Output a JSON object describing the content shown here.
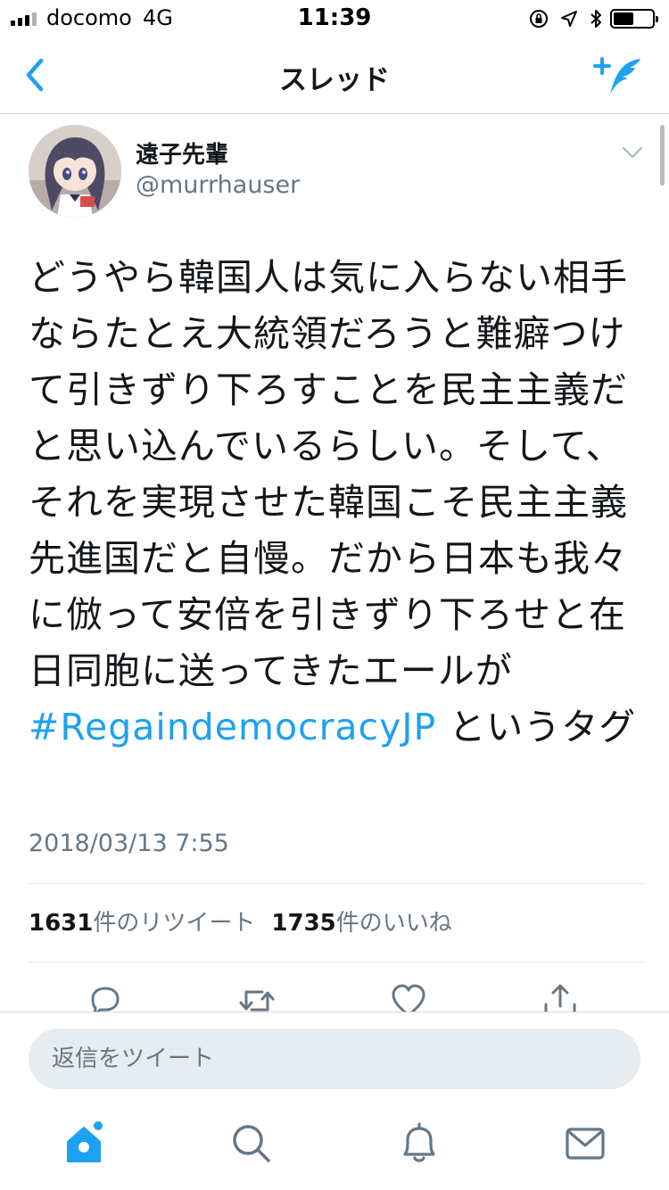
{
  "status_bar": {
    "carrier": "docomo",
    "network": "4G",
    "time": "11:39",
    "icons": [
      "signal-icon",
      "orientation-lock-icon",
      "location-icon",
      "bluetooth-icon",
      "battery-icon"
    ]
  },
  "nav": {
    "title": "スレッド",
    "back_icon": "chevron-left-icon",
    "compose_icon": "compose-tweet-icon"
  },
  "tweet": {
    "author_name": "遠子先輩",
    "author_handle": "@murrhauser",
    "text_before_hashtag": "どうやら韓国人は気に入らない相手ならたとえ大統領だろうと難癖つけて引きずり下ろすことを民主主義だと思い込んでいるらしい。そして、それを実現させた韓国こそ民主主義先進国だと自慢。だから日本も我々に倣って安倍を引きずり下ろせと在日同胞に送ってきたエールが ",
    "hashtag": "#RegaindemocracyJP",
    "text_after_hashtag": " というタグ",
    "timestamp": "2018/03/13 7:55",
    "retweet_count": "1631",
    "retweet_label": "件のリツイート",
    "like_count": "1735",
    "like_label": "件のいいね"
  },
  "actions": [
    "reply-icon",
    "retweet-icon",
    "like-icon",
    "share-icon"
  ],
  "reply_bar": {
    "placeholder": "返信をツイート"
  },
  "tab_bar": {
    "tabs": [
      "home-icon",
      "search-icon",
      "notifications-icon",
      "messages-icon"
    ],
    "active": "home-icon"
  },
  "colors": {
    "accent": "#1da1f2",
    "text": "#14171a",
    "secondary": "#657786",
    "icon_gray": "#657786"
  }
}
